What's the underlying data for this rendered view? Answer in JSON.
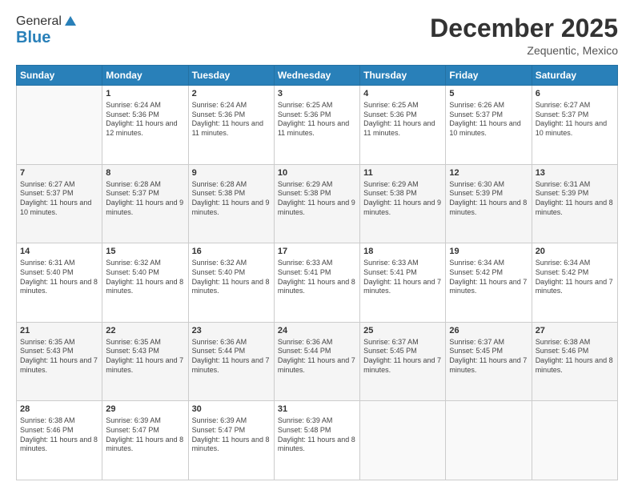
{
  "logo": {
    "general": "General",
    "blue": "Blue"
  },
  "title": "December 2025",
  "location": "Zequentic, Mexico",
  "days_of_week": [
    "Sunday",
    "Monday",
    "Tuesday",
    "Wednesday",
    "Thursday",
    "Friday",
    "Saturday"
  ],
  "weeks": [
    [
      {
        "day": "",
        "sunrise": "",
        "sunset": "",
        "daylight": "",
        "empty": true
      },
      {
        "day": "1",
        "sunrise": "Sunrise: 6:24 AM",
        "sunset": "Sunset: 5:36 PM",
        "daylight": "Daylight: 11 hours and 12 minutes."
      },
      {
        "day": "2",
        "sunrise": "Sunrise: 6:24 AM",
        "sunset": "Sunset: 5:36 PM",
        "daylight": "Daylight: 11 hours and 11 minutes."
      },
      {
        "day": "3",
        "sunrise": "Sunrise: 6:25 AM",
        "sunset": "Sunset: 5:36 PM",
        "daylight": "Daylight: 11 hours and 11 minutes."
      },
      {
        "day": "4",
        "sunrise": "Sunrise: 6:25 AM",
        "sunset": "Sunset: 5:36 PM",
        "daylight": "Daylight: 11 hours and 11 minutes."
      },
      {
        "day": "5",
        "sunrise": "Sunrise: 6:26 AM",
        "sunset": "Sunset: 5:37 PM",
        "daylight": "Daylight: 11 hours and 10 minutes."
      },
      {
        "day": "6",
        "sunrise": "Sunrise: 6:27 AM",
        "sunset": "Sunset: 5:37 PM",
        "daylight": "Daylight: 11 hours and 10 minutes."
      }
    ],
    [
      {
        "day": "7",
        "sunrise": "Sunrise: 6:27 AM",
        "sunset": "Sunset: 5:37 PM",
        "daylight": "Daylight: 11 hours and 10 minutes."
      },
      {
        "day": "8",
        "sunrise": "Sunrise: 6:28 AM",
        "sunset": "Sunset: 5:37 PM",
        "daylight": "Daylight: 11 hours and 9 minutes."
      },
      {
        "day": "9",
        "sunrise": "Sunrise: 6:28 AM",
        "sunset": "Sunset: 5:38 PM",
        "daylight": "Daylight: 11 hours and 9 minutes."
      },
      {
        "day": "10",
        "sunrise": "Sunrise: 6:29 AM",
        "sunset": "Sunset: 5:38 PM",
        "daylight": "Daylight: 11 hours and 9 minutes."
      },
      {
        "day": "11",
        "sunrise": "Sunrise: 6:29 AM",
        "sunset": "Sunset: 5:38 PM",
        "daylight": "Daylight: 11 hours and 9 minutes."
      },
      {
        "day": "12",
        "sunrise": "Sunrise: 6:30 AM",
        "sunset": "Sunset: 5:39 PM",
        "daylight": "Daylight: 11 hours and 8 minutes."
      },
      {
        "day": "13",
        "sunrise": "Sunrise: 6:31 AM",
        "sunset": "Sunset: 5:39 PM",
        "daylight": "Daylight: 11 hours and 8 minutes."
      }
    ],
    [
      {
        "day": "14",
        "sunrise": "Sunrise: 6:31 AM",
        "sunset": "Sunset: 5:40 PM",
        "daylight": "Daylight: 11 hours and 8 minutes."
      },
      {
        "day": "15",
        "sunrise": "Sunrise: 6:32 AM",
        "sunset": "Sunset: 5:40 PM",
        "daylight": "Daylight: 11 hours and 8 minutes."
      },
      {
        "day": "16",
        "sunrise": "Sunrise: 6:32 AM",
        "sunset": "Sunset: 5:40 PM",
        "daylight": "Daylight: 11 hours and 8 minutes."
      },
      {
        "day": "17",
        "sunrise": "Sunrise: 6:33 AM",
        "sunset": "Sunset: 5:41 PM",
        "daylight": "Daylight: 11 hours and 8 minutes."
      },
      {
        "day": "18",
        "sunrise": "Sunrise: 6:33 AM",
        "sunset": "Sunset: 5:41 PM",
        "daylight": "Daylight: 11 hours and 7 minutes."
      },
      {
        "day": "19",
        "sunrise": "Sunrise: 6:34 AM",
        "sunset": "Sunset: 5:42 PM",
        "daylight": "Daylight: 11 hours and 7 minutes."
      },
      {
        "day": "20",
        "sunrise": "Sunrise: 6:34 AM",
        "sunset": "Sunset: 5:42 PM",
        "daylight": "Daylight: 11 hours and 7 minutes."
      }
    ],
    [
      {
        "day": "21",
        "sunrise": "Sunrise: 6:35 AM",
        "sunset": "Sunset: 5:43 PM",
        "daylight": "Daylight: 11 hours and 7 minutes."
      },
      {
        "day": "22",
        "sunrise": "Sunrise: 6:35 AM",
        "sunset": "Sunset: 5:43 PM",
        "daylight": "Daylight: 11 hours and 7 minutes."
      },
      {
        "day": "23",
        "sunrise": "Sunrise: 6:36 AM",
        "sunset": "Sunset: 5:44 PM",
        "daylight": "Daylight: 11 hours and 7 minutes."
      },
      {
        "day": "24",
        "sunrise": "Sunrise: 6:36 AM",
        "sunset": "Sunset: 5:44 PM",
        "daylight": "Daylight: 11 hours and 7 minutes."
      },
      {
        "day": "25",
        "sunrise": "Sunrise: 6:37 AM",
        "sunset": "Sunset: 5:45 PM",
        "daylight": "Daylight: 11 hours and 7 minutes."
      },
      {
        "day": "26",
        "sunrise": "Sunrise: 6:37 AM",
        "sunset": "Sunset: 5:45 PM",
        "daylight": "Daylight: 11 hours and 7 minutes."
      },
      {
        "day": "27",
        "sunrise": "Sunrise: 6:38 AM",
        "sunset": "Sunset: 5:46 PM",
        "daylight": "Daylight: 11 hours and 8 minutes."
      }
    ],
    [
      {
        "day": "28",
        "sunrise": "Sunrise: 6:38 AM",
        "sunset": "Sunset: 5:46 PM",
        "daylight": "Daylight: 11 hours and 8 minutes."
      },
      {
        "day": "29",
        "sunrise": "Sunrise: 6:39 AM",
        "sunset": "Sunset: 5:47 PM",
        "daylight": "Daylight: 11 hours and 8 minutes."
      },
      {
        "day": "30",
        "sunrise": "Sunrise: 6:39 AM",
        "sunset": "Sunset: 5:47 PM",
        "daylight": "Daylight: 11 hours and 8 minutes."
      },
      {
        "day": "31",
        "sunrise": "Sunrise: 6:39 AM",
        "sunset": "Sunset: 5:48 PM",
        "daylight": "Daylight: 11 hours and 8 minutes."
      },
      {
        "day": "",
        "sunrise": "",
        "sunset": "",
        "daylight": "",
        "empty": true
      },
      {
        "day": "",
        "sunrise": "",
        "sunset": "",
        "daylight": "",
        "empty": true
      },
      {
        "day": "",
        "sunrise": "",
        "sunset": "",
        "daylight": "",
        "empty": true
      }
    ]
  ]
}
